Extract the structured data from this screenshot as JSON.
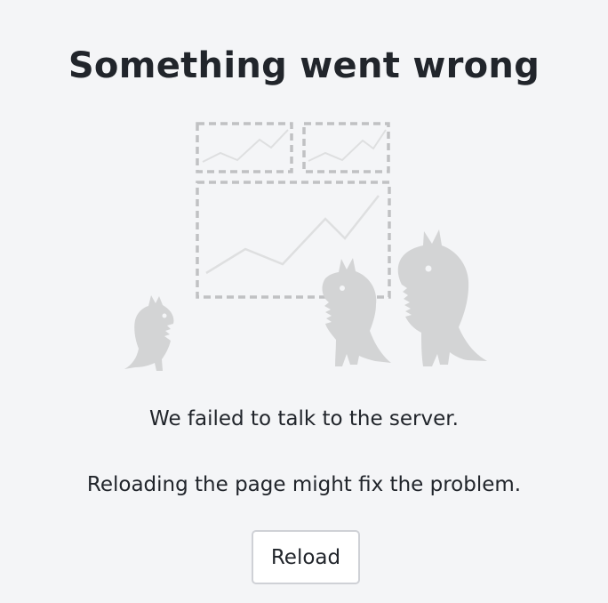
{
  "error": {
    "title": "Something went wrong",
    "message": "We failed to talk to the server.",
    "hint": "Reloading the page might fix the problem.",
    "reload_label": "Reload"
  },
  "illustration": {
    "icon": "monsters-with-broken-charts-illustration"
  },
  "colors": {
    "background": "#f4f5f7",
    "text": "#21252b",
    "illustration_gray": "#d3d4d5",
    "dash_gray": "#c0c1c3",
    "button_border": "#cfd1d6"
  }
}
